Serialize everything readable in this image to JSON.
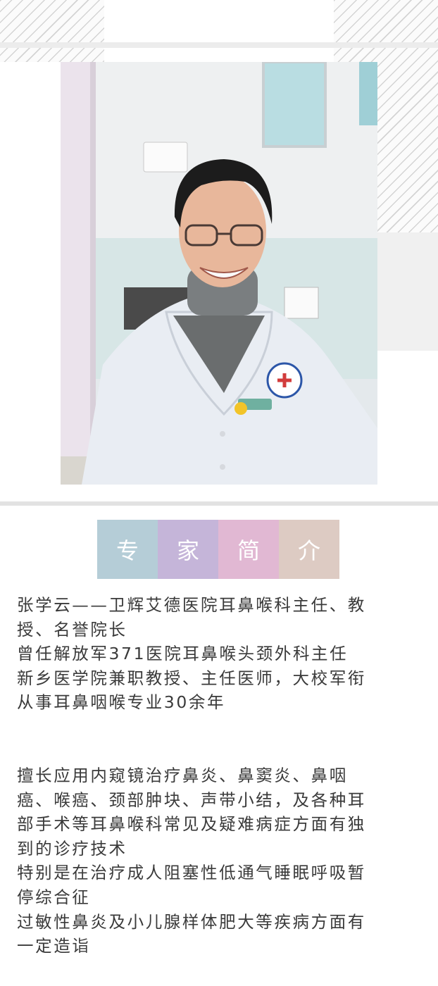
{
  "section_title": {
    "chars": [
      "专",
      "家",
      "简",
      "介"
    ],
    "colors": [
      "#b5cdd7",
      "#c5b5d9",
      "#e1b8d3",
      "#ddcbc3"
    ]
  },
  "intro": {
    "lines": [
      "张学云——卫辉艾德医院耳鼻喉科主任、教",
      "授、名誉院长",
      "曾任解放军371医院耳鼻喉头颈外科主任",
      "新乡医学院兼职教授、主任医师，大校军衔",
      "从事耳鼻咽喉专业30余年"
    ]
  },
  "specialty": {
    "lines": [
      "擅长应用内窥镜治疗鼻炎、鼻窦炎、鼻咽",
      "癌、喉癌、颈部肿块、声带小结，及各种耳",
      "部手术等耳鼻喉科常见及疑难病症方面有独",
      "到的诊疗技术",
      "特别是在治疗成人阻塞性低通气睡眠呼吸暂",
      "停综合征",
      "过敏性鼻炎及小儿腺样体肥大等疾病方面有",
      "一定造诣"
    ]
  }
}
